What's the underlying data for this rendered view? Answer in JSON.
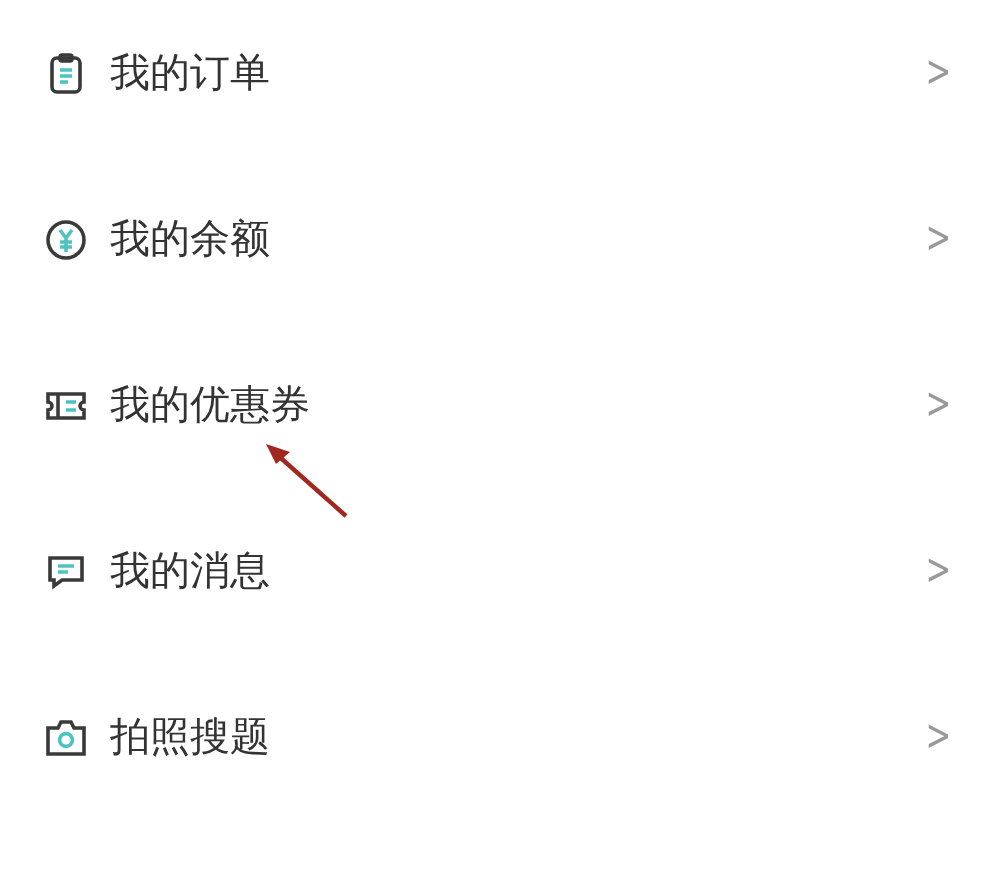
{
  "menu": [
    {
      "kind": "orders",
      "label": "我的订单",
      "chevron": ">"
    },
    {
      "kind": "balance",
      "label": "我的余额",
      "chevron": ">"
    },
    {
      "kind": "coupons",
      "label": "我的优惠券",
      "chevron": ">"
    },
    {
      "kind": "messages",
      "label": "我的消息",
      "chevron": ">"
    },
    {
      "kind": "photo-search",
      "label": "拍照搜题",
      "chevron": ">"
    }
  ],
  "annotation": {
    "kind": "arrow",
    "color": "#a0281e"
  }
}
